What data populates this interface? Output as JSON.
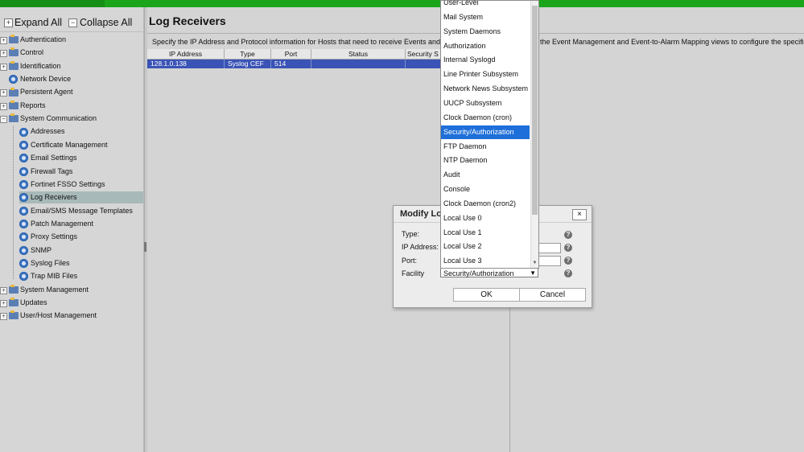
{
  "toolbar": {
    "expand_all": "Expand All",
    "collapse_all": "Collapse All"
  },
  "tree": [
    {
      "label": "Authentication",
      "type": "folder",
      "expander": "+"
    },
    {
      "label": "Control",
      "type": "folder",
      "expander": "+"
    },
    {
      "label": "Identification",
      "type": "folder",
      "expander": "+"
    },
    {
      "label": "Network Device",
      "type": "gear",
      "expander": ""
    },
    {
      "label": "Persistent Agent",
      "type": "folder",
      "expander": "+"
    },
    {
      "label": "Reports",
      "type": "folder",
      "expander": "+"
    },
    {
      "label": "System Communication",
      "type": "folder",
      "expander": "−"
    },
    {
      "label": "Addresses",
      "type": "gear-child",
      "expander": ""
    },
    {
      "label": "Certificate Management",
      "type": "gear-child",
      "expander": ""
    },
    {
      "label": "Email Settings",
      "type": "gear-child",
      "expander": ""
    },
    {
      "label": "Firewall Tags",
      "type": "gear-child",
      "expander": ""
    },
    {
      "label": "Fortinet FSSO Settings",
      "type": "gear-child",
      "expander": ""
    },
    {
      "label": "Log Receivers",
      "type": "gear-child",
      "expander": "",
      "selected": true
    },
    {
      "label": "Email/SMS Message Templates",
      "type": "gear-child",
      "expander": ""
    },
    {
      "label": "Patch Management",
      "type": "gear-child",
      "expander": ""
    },
    {
      "label": "Proxy Settings",
      "type": "gear-child",
      "expander": ""
    },
    {
      "label": "SNMP",
      "type": "gear-child",
      "expander": ""
    },
    {
      "label": "Syslog Files",
      "type": "gear-child",
      "expander": ""
    },
    {
      "label": "Trap MIB Files",
      "type": "gear-child",
      "expander": ""
    },
    {
      "label": "System Management",
      "type": "folder",
      "expander": "+"
    },
    {
      "label": "Updates",
      "type": "folder",
      "expander": "+"
    },
    {
      "label": "User/Host Management",
      "type": "folder",
      "expander": "+"
    }
  ],
  "page": {
    "title": "Log Receivers",
    "description_left": "Specify the IP Address and Protocol information for Hosts that need to receive Events and/",
    "description_right": "the Event Management and Event-to-Alarm Mapping views to configure the specific"
  },
  "grid": {
    "columns": [
      "IP Address",
      "Type",
      "Port",
      "Status",
      "Security S"
    ],
    "rows": [
      {
        "ip": "128.1.0.138",
        "type": "Syslog CEF",
        "port": "514",
        "status": "",
        "security": ""
      }
    ]
  },
  "dialog": {
    "title": "Modify Lo",
    "close": "×",
    "labels": {
      "type": "Type:",
      "ip": "IP Address:",
      "port": "Port:",
      "facility": "Facility"
    },
    "facility_value": "Security/Authorization",
    "ok": "OK",
    "cancel": "Cancel",
    "help": "?"
  },
  "dropdown": {
    "options": [
      "User-Level",
      "Mail System",
      "System Daemons",
      "Authorization",
      "Internal Syslogd",
      "Line Printer Subsystem",
      "Network News Subsystem",
      "UUCP Subsystem",
      "Clock Daemon (cron)",
      "Security/Authorization",
      "FTP Daemon",
      "NTP Daemon",
      "Audit",
      "Console",
      "Clock Daemon (cron2)",
      "Local Use 0",
      "Local Use 1",
      "Local Use 2",
      "Local Use 3"
    ],
    "selected": "Security/Authorization"
  },
  "colors": {
    "topbar": "#1aa51a",
    "selection_blue": "#3a53b6",
    "dropdown_highlight": "#1e6fd9"
  }
}
